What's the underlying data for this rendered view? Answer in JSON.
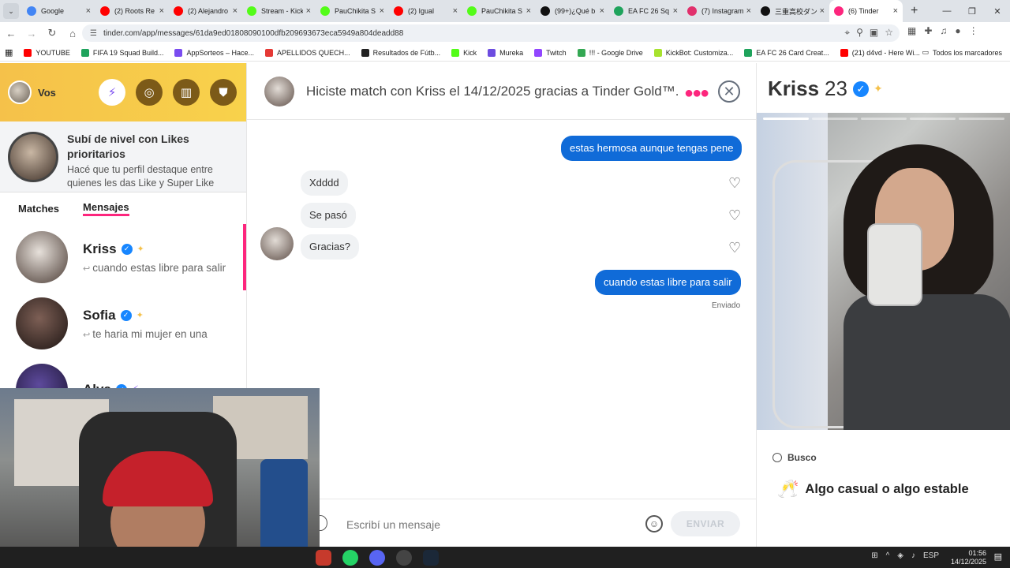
{
  "browser": {
    "tabs": [
      {
        "title": "Google",
        "color": "#4285f4"
      },
      {
        "title": "(2) Roots Re",
        "color": "#ff0000"
      },
      {
        "title": "(2) Alejandro",
        "color": "#ff0000"
      },
      {
        "title": "Stream - Kick",
        "color": "#53fc18"
      },
      {
        "title": "PauChikita S",
        "color": "#53fc18"
      },
      {
        "title": "(2) Igual",
        "color": "#ff0000"
      },
      {
        "title": "PauChikita S",
        "color": "#53fc18"
      },
      {
        "title": "(99+)¿Qué b",
        "color": "#111111"
      },
      {
        "title": "EA FC 26 Sq",
        "color": "#1fa35c"
      },
      {
        "title": "(7) Instagram",
        "color": "#e1306c"
      },
      {
        "title": "三重高校ダン",
        "color": "#111111"
      },
      {
        "title": "(6) Tinder",
        "color": "#fd267d"
      }
    ],
    "url": "tinder.com/app/messages/61da9ed01808090100dfb209693673eca5949a804deadd88",
    "bookmarks": [
      {
        "label": "YOUTUBE",
        "color": "#ff0000"
      },
      {
        "label": "FIFA 19 Squad Build...",
        "color": "#1fa35c"
      },
      {
        "label": "AppSorteos – Hace...",
        "color": "#7a4cf0"
      },
      {
        "label": "APELLIDOS QUECH...",
        "color": "#e53935"
      },
      {
        "label": "Resultados de Fútb...",
        "color": "#222222"
      },
      {
        "label": "Kick",
        "color": "#53fc18"
      },
      {
        "label": "Mureka",
        "color": "#6c4ce0"
      },
      {
        "label": "Twitch",
        "color": "#9146ff"
      },
      {
        "label": "!!! - Google Drive",
        "color": "#34a853"
      },
      {
        "label": "KickBot: Customiza...",
        "color": "#a7e22e"
      },
      {
        "label": "EA FC 26 Card Creat...",
        "color": "#1fa35c"
      },
      {
        "label": "(21) d4vd - Here Wi...",
        "color": "#ff0000"
      }
    ],
    "all_bookmarks": "Todos los marcadores"
  },
  "sidebar": {
    "user_name": "Vos",
    "promo_title": "Subí de nivel con Likes prioritarios",
    "promo_sub": "Hacé que tu perfil destaque entre quienes les das Like y Super Like",
    "tab_matches": "Matches",
    "tab_messages": "Mensajes",
    "conversations": [
      {
        "name": "Kriss",
        "last": "cuando estas libre para salir"
      },
      {
        "name": "Sofia",
        "last": "te haria mi mujer en una"
      },
      {
        "name": "Alva",
        "last": ""
      }
    ]
  },
  "chat": {
    "header": "Hiciste match con Kriss el 14/12/2025 gracias a Tinder Gold™.",
    "messages": [
      {
        "text": "estas hermosa aunque tengas pene",
        "dir": "out"
      },
      {
        "text": "Xdddd",
        "dir": "in"
      },
      {
        "text": "Se pasó",
        "dir": "in"
      },
      {
        "text": "Gracias?",
        "dir": "in"
      },
      {
        "text": "cuando estas libre para salir",
        "dir": "out"
      }
    ],
    "status": "Enviado",
    "placeholder": "Escribí un mensaje",
    "send_label": "ENVIAR"
  },
  "profile": {
    "name": "Kriss",
    "age": "23",
    "busco_label": "Busco",
    "looking_for": "Algo casual o algo estable"
  },
  "taskbar": {
    "lang": "ESP",
    "time": "01:56",
    "date": "14/12/2025"
  }
}
